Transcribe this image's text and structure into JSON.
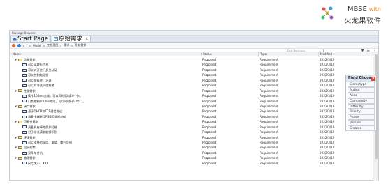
{
  "logo": {
    "line1_main": "MBSE",
    "line1_accent": "with",
    "line2": "火龙果软件",
    "accent_color": "#f28c28"
  },
  "window": {
    "title": "Package Browser",
    "tabs": [
      {
        "label": "Start Page",
        "icon": "home-icon"
      },
      {
        "label": "原始需求",
        "icon": "diagram-icon",
        "close": "×"
      }
    ],
    "breadcrumb": [
      "Model",
      "工程视图",
      "需求",
      "原始需求"
    ],
    "find_placeholder": "Find Package"
  },
  "columns": {
    "name": "Name",
    "status": "Status",
    "type": "Type",
    "modified": "Modified"
  },
  "rows": [
    {
      "level": 0,
      "kind": "pkg",
      "name": "功能需求",
      "status": "Proposed",
      "type": "Requirement",
      "modified": "2022/3/19"
    },
    {
      "level": 1,
      "kind": "req",
      "name": "可以读取卡信息",
      "status": "Proposed",
      "type": "Requirement",
      "modified": "2022/3/19"
    },
    {
      "level": 1,
      "kind": "req",
      "name": "可以对开进行身份认证",
      "status": "Proposed",
      "type": "Requirement",
      "modified": "2022/3/19"
    },
    {
      "level": 1,
      "kind": "req",
      "name": "可以控制电磁锁",
      "status": "Proposed",
      "type": "Requirement",
      "modified": "2022/3/19"
    },
    {
      "level": 1,
      "kind": "req",
      "name": "可以保存进门记录",
      "status": "Proposed",
      "type": "Requirement",
      "modified": "2022/3/19"
    },
    {
      "level": 1,
      "kind": "req",
      "name": "可以对非法入侵报警",
      "status": "Proposed",
      "type": "Requirement",
      "modified": "2022/3/19"
    },
    {
      "level": 0,
      "kind": "pkg",
      "name": "性能需求",
      "status": "Proposed",
      "type": "Requirement",
      "modified": "2022/3/19"
    },
    {
      "level": 1,
      "kind": "req",
      "name": "读卡100ms完成，可以同时读取10个卡。",
      "status": "Proposed",
      "type": "Requirement",
      "modified": "2022/3/19"
    },
    {
      "level": 1,
      "kind": "req",
      "name": "门禁控制200ms完成，可以同时开10个门。",
      "status": "Proposed",
      "type": "Requirement",
      "modified": "2022/3/19"
    },
    {
      "level": 0,
      "kind": "pkg",
      "name": "接口需求",
      "status": "Proposed",
      "type": "Requirement",
      "modified": "2022/3/19"
    },
    {
      "level": 1,
      "kind": "req",
      "name": "基于DHCP和TCP通信协议",
      "status": "Proposed",
      "type": "Requirement",
      "modified": "2022/3/19"
    },
    {
      "level": 1,
      "kind": "req",
      "name": "具备卡端采用RS485通信协议",
      "status": "Proposed",
      "type": "Requirement",
      "modified": "2022/3/19"
    },
    {
      "level": 0,
      "kind": "pkg",
      "name": "可靠性需求",
      "status": "Proposed",
      "type": "Requirement",
      "modified": "2022/3/19"
    },
    {
      "level": 1,
      "kind": "req",
      "name": "具备具有掉电保护功能",
      "status": "Proposed",
      "type": "Requirement",
      "modified": "2022/3/19"
    },
    {
      "level": 1,
      "kind": "req",
      "name": "对于非法读取能够识别",
      "status": "Proposed",
      "type": "Requirement",
      "modified": "2022/3/19"
    },
    {
      "level": 0,
      "kind": "pkg",
      "name": "环境需求",
      "status": "Proposed",
      "type": "Requirement",
      "modified": "2022/3/19"
    },
    {
      "level": 1,
      "kind": "req",
      "name": "可以支持的温度、湿度、电气范围",
      "status": "Proposed",
      "type": "Requirement",
      "modified": "2022/3/19"
    },
    {
      "level": 0,
      "kind": "pkg",
      "name": "设计约束",
      "status": "Proposed",
      "type": "Requirement",
      "modified": "2022/3/19"
    },
    {
      "level": 1,
      "kind": "req",
      "name": "采用单片机",
      "status": "Proposed",
      "type": "Requirement",
      "modified": "2022/3/19"
    },
    {
      "level": 0,
      "kind": "pkg",
      "name": "物理需求",
      "status": "Proposed",
      "type": "Requirement",
      "modified": "2022/3/19"
    },
    {
      "level": 1,
      "kind": "req",
      "name": "尺寸大小：XXX",
      "status": "Proposed",
      "type": "Requirement",
      "modified": "2022/3/19"
    }
  ],
  "field_chooser": {
    "title": "Field Chooser",
    "items": [
      "Stereotype",
      "Author",
      "Alias",
      "Complexity",
      "Difficulty",
      "Priority",
      "Phase",
      "Version",
      "Created"
    ]
  }
}
